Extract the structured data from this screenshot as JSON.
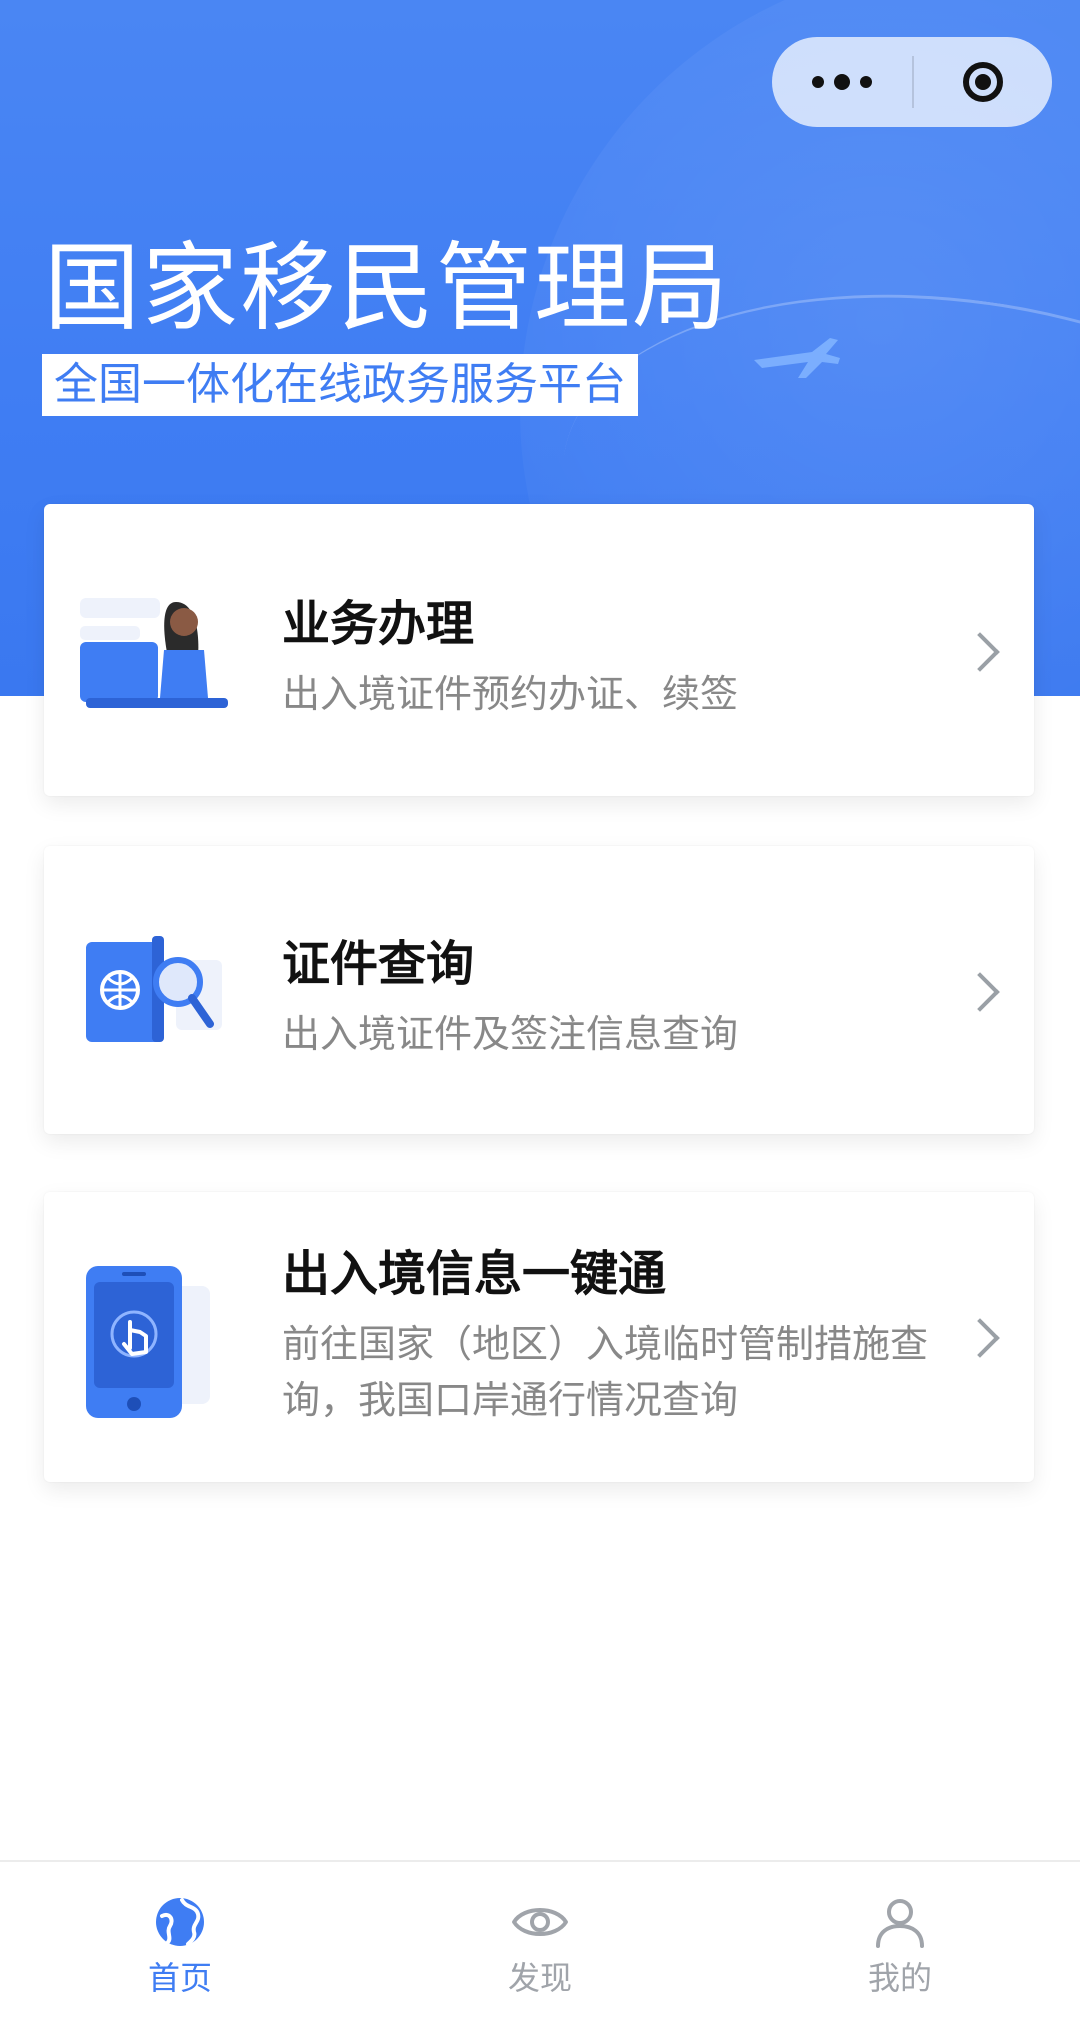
{
  "header": {
    "title": "国家移民管理局",
    "subtitle": "全国一体化在线政务服务平台"
  },
  "capsule": {
    "more_icon": "more-dots-icon",
    "close_icon": "target-circle-icon"
  },
  "cards": [
    {
      "title": "业务办理",
      "description": "出入境证件预约办证、续签",
      "icon": "woman-laptop-illustration"
    },
    {
      "title": "证件查询",
      "description": "出入境证件及签注信息查询",
      "icon": "passport-search-illustration"
    },
    {
      "title": "出入境信息一键通",
      "description": "前往国家（地区）入境临时管制措施查询，我国口岸通行情况查询",
      "icon": "phone-touch-illustration"
    }
  ],
  "tabbar": {
    "items": [
      {
        "label": "首页",
        "icon": "globe-icon",
        "active": true
      },
      {
        "label": "发现",
        "icon": "eye-icon",
        "active": false
      },
      {
        "label": "我的",
        "icon": "user-icon",
        "active": false
      }
    ]
  },
  "colors": {
    "primary": "#3f7df3",
    "text": "#111111",
    "muted": "#888888",
    "inactive": "#a0a4aa"
  }
}
